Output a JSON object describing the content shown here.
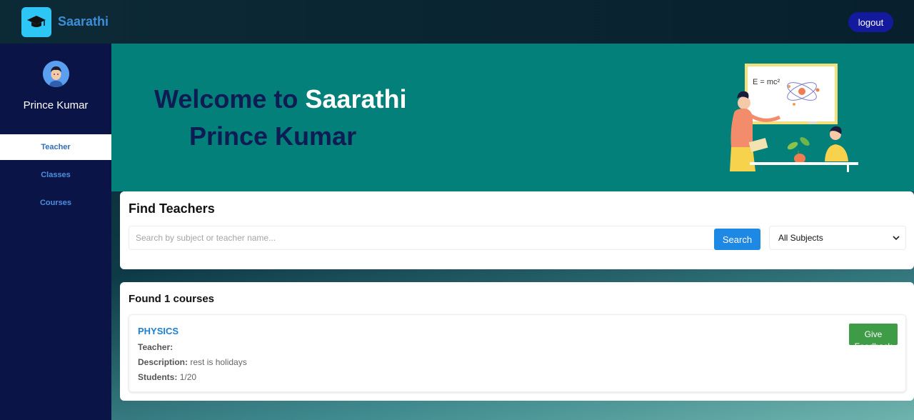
{
  "header": {
    "brand": "Saarathi",
    "logout_label": "logout",
    "logo_icon": "graduation-cap-icon",
    "brand_color": "#3b8fd9"
  },
  "sidebar": {
    "user_name": "Prince Kumar",
    "items": [
      {
        "label": "Teacher",
        "active": true
      },
      {
        "label": "Classes",
        "active": false
      },
      {
        "label": "Courses",
        "active": false
      }
    ]
  },
  "hero": {
    "welcome_prefix": "Welcome to",
    "brand": "Saarathi",
    "user_name": "Prince Kumar",
    "background": "#04807b"
  },
  "find": {
    "title": "Find Teachers",
    "search_placeholder": "Search by subject or teacher name...",
    "search_value": "",
    "search_button": "Search",
    "subject_selected": "All Subjects"
  },
  "results": {
    "heading": "Found 1 courses",
    "courses": [
      {
        "name": "PHYSICS",
        "teacher_label": "Teacher:",
        "teacher_value": "",
        "description_label": "Description:",
        "description_value": "rest is holidays",
        "students_label": "Students:",
        "students_value": "1/20",
        "action_label": "Give Feedback"
      }
    ]
  }
}
